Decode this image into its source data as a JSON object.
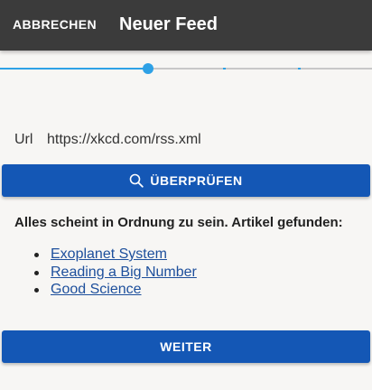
{
  "appbar": {
    "cancel_label": "ABBRECHEN",
    "title": "Neuer Feed"
  },
  "stepper": {
    "current_step": 3,
    "total_steps": 5
  },
  "form": {
    "url_label": "Url",
    "url_value": "https://xkcd.com/rss.xml",
    "check_button_label": "ÜBERPRÜFEN",
    "check_button_icon": "search-icon"
  },
  "result": {
    "message": "Alles scheint in Ordnung zu sein. Artikel gefunden:",
    "articles": [
      "Exoplanet System",
      "Reading a Big Number",
      "Good Science"
    ]
  },
  "footer": {
    "next_button_label": "WEITER"
  },
  "colors": {
    "appbar": "#3b3b3b",
    "primary": "#1457b5",
    "progress": "#2ea1e6",
    "link": "#1d4f9c",
    "background": "#f7f6f4"
  }
}
